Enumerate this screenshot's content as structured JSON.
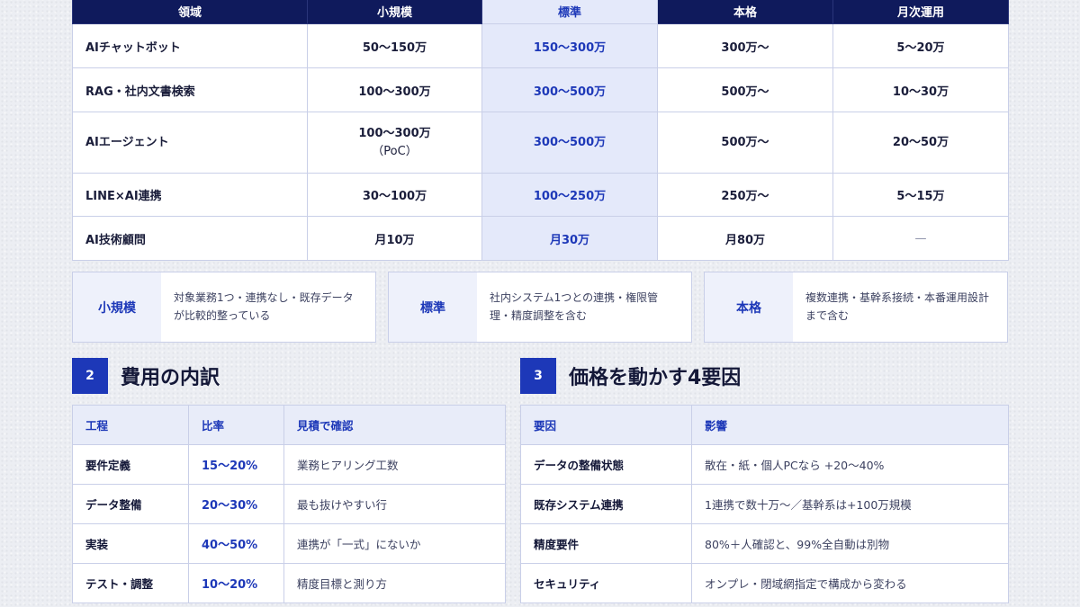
{
  "price_table": {
    "headers": [
      "領域",
      "小規模",
      "標準",
      "本格",
      "月次運用"
    ],
    "rows": [
      [
        "AIチャットボット",
        "50〜150万",
        "150〜300万",
        "300万〜",
        "5〜20万"
      ],
      [
        "RAG・社内文書検索",
        "100〜300万",
        "300〜500万",
        "500万〜",
        "10〜30万"
      ],
      [
        "AIエージェント",
        "100〜300万",
        "300〜500万",
        "500万〜",
        "20〜50万"
      ],
      [
        "LINE×AI連携",
        "30〜100万",
        "100〜250万",
        "250万〜",
        "5〜15万"
      ],
      [
        "AI技術顧問",
        "月10万",
        "月30万",
        "月80万",
        "—"
      ]
    ],
    "row3_note": "（PoC）"
  },
  "definitions": [
    {
      "label": "小規模",
      "text": "対象業務1つ・連携なし・既存データが比較的整っている"
    },
    {
      "label": "標準",
      "text": "社内システム1つとの連携・権限管理・精度調整を含む"
    },
    {
      "label": "本格",
      "text": "複数連携・基幹系接続・本番運用設計まで含む"
    }
  ],
  "section2": {
    "number": "2",
    "title": "費用の内訳",
    "headers": [
      "工程",
      "比率",
      "見積で確認"
    ],
    "rows": [
      [
        "要件定義",
        "15〜20%",
        "業務ヒアリング工数"
      ],
      [
        "データ整備",
        "20〜30%",
        "最も抜けやすい行"
      ],
      [
        "実装",
        "40〜50%",
        "連携が「一式」にないか"
      ],
      [
        "テスト・調整",
        "10〜20%",
        "精度目標と測り方"
      ]
    ]
  },
  "section3": {
    "number": "3",
    "title": "価格を動かす4要因",
    "headers": [
      "要因",
      "影響"
    ],
    "rows": [
      [
        "データの整備状態",
        "散在・紙・個人PCなら +20〜40%"
      ],
      [
        "既存システム連携",
        "1連携で数十万〜／基幹系は+100万規模"
      ],
      [
        "精度要件",
        "80%＋人確認と、99%全自動は別物"
      ],
      [
        "セキュリティ",
        "オンプレ・閉域網指定で構成から変わる"
      ]
    ]
  }
}
